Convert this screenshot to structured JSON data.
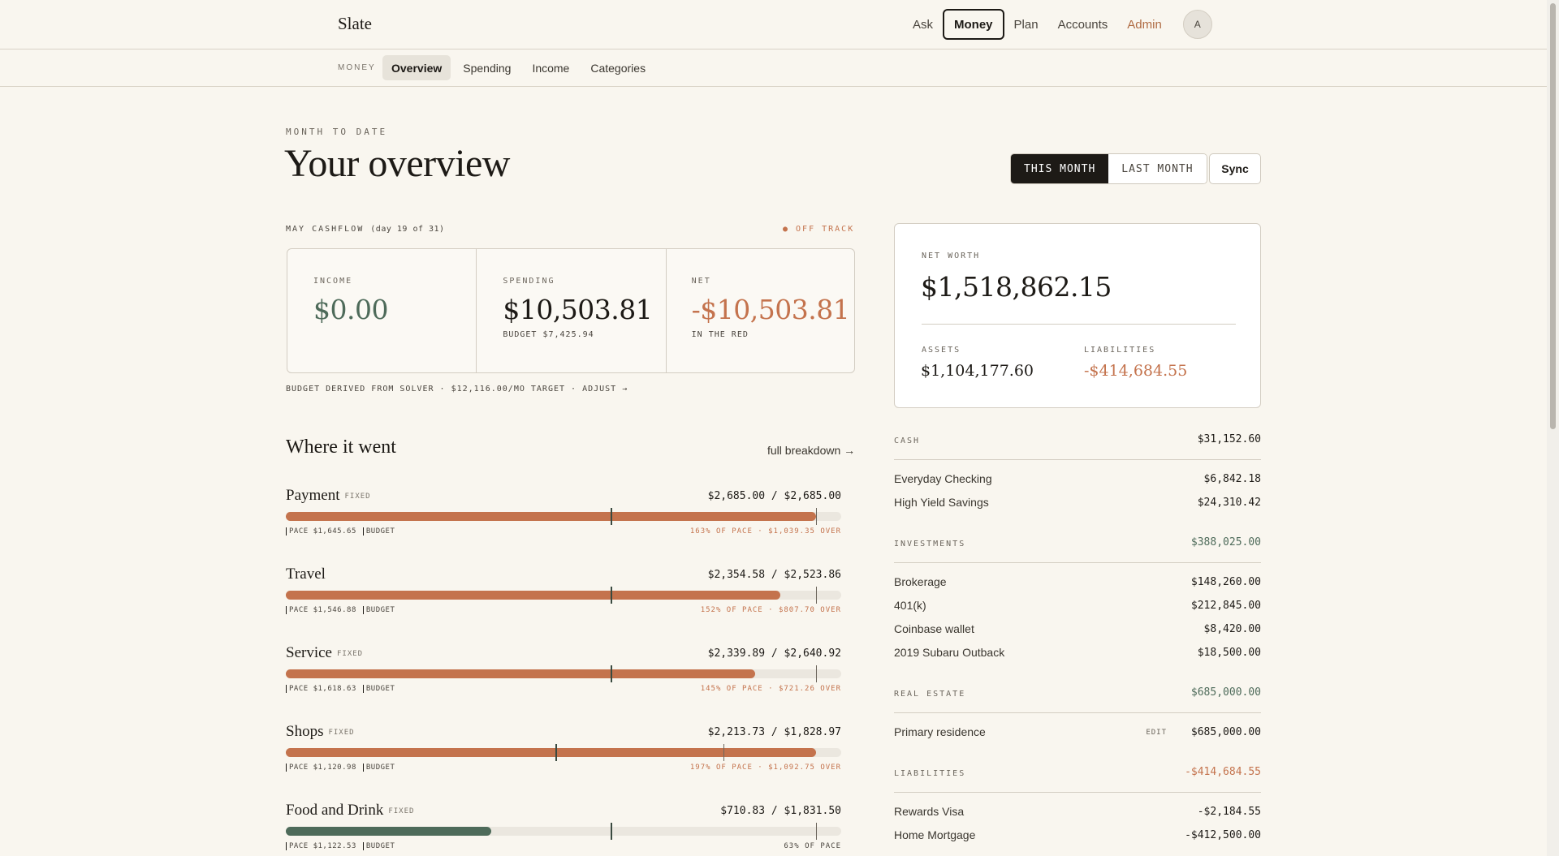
{
  "brand": "Slate",
  "nav": {
    "items": [
      {
        "label": "Ask"
      },
      {
        "label": "Money"
      },
      {
        "label": "Plan"
      },
      {
        "label": "Accounts"
      },
      {
        "label": "Admin"
      }
    ],
    "avatar": "A"
  },
  "subnav": {
    "section": "MONEY",
    "tabs": [
      {
        "label": "Overview"
      },
      {
        "label": "Spending"
      },
      {
        "label": "Income"
      },
      {
        "label": "Categories"
      }
    ]
  },
  "header": {
    "eyebrow": "MONTH TO DATE",
    "title": "Your overview",
    "this_month": "THIS MONTH",
    "last_month": "LAST MONTH",
    "sync": "Sync"
  },
  "cashflow": {
    "title": "MAY CASHFLOW",
    "day": "(day 19 of 31)",
    "status": "● OFF TRACK",
    "income_label": "INCOME",
    "income": "$0.00",
    "spending_label": "SPENDING",
    "spending": "$10,503.81",
    "budget": "BUDGET $7,425.94",
    "net_label": "NET",
    "net": "-$10,503.81",
    "net_sub": "IN THE RED",
    "note": "BUDGET DERIVED FROM SOLVER · $12,116.00/MO TARGET · ADJUST →"
  },
  "where": {
    "title": "Where it went",
    "link": "full breakdown →",
    "categories": [
      {
        "name": "Payment",
        "tag": "FIXED",
        "amount": "$2,685.00 / $2,685.00",
        "pace": "PACE $1,645.65",
        "budget": "BUDGET",
        "status": "163% OF PACE · $1,039.35 OVER",
        "fill": 0.955,
        "pace_pos": 0.585,
        "budget_pos": 0.955
      },
      {
        "name": "Travel",
        "tag": "",
        "amount": "$2,354.58 / $2,523.86",
        "pace": "PACE $1,546.88",
        "budget": "BUDGET",
        "status": "152% OF PACE · $807.70 OVER",
        "fill": 0.89,
        "pace_pos": 0.585,
        "budget_pos": 0.955
      },
      {
        "name": "Service",
        "tag": "FIXED",
        "amount": "$2,339.89 / $2,640.92",
        "pace": "PACE $1,618.63",
        "budget": "BUDGET",
        "status": "145% OF PACE · $721.26 OVER",
        "fill": 0.845,
        "pace_pos": 0.585,
        "budget_pos": 0.955
      },
      {
        "name": "Shops",
        "tag": "FIXED",
        "amount": "$2,213.73 / $1,828.97",
        "pace": "PACE $1,120.98",
        "budget": "BUDGET",
        "status": "197% OF PACE · $1,092.75 OVER",
        "fill": 0.955,
        "pace_pos": 0.485,
        "budget_pos": 0.788
      },
      {
        "name": "Food and Drink",
        "tag": "FIXED",
        "amount": "$710.83 / $1,831.50",
        "pace": "PACE $1,122.53",
        "budget": "BUDGET",
        "status": "63% OF PACE",
        "fill": 0.37,
        "pace_pos": 0.585,
        "budget_pos": 0.955
      }
    ]
  },
  "networth": {
    "label": "NET WORTH",
    "value": "$1,518,862.15",
    "assets_label": "ASSETS",
    "assets": "$1,104,177.60",
    "liabilities_label": "LIABILITIES",
    "liabilities": "-$414,684.55"
  },
  "accounts": {
    "cash": {
      "label": "CASH",
      "total": "$31,152.60",
      "rows": [
        {
          "name": "Everyday Checking",
          "value": "$6,842.18"
        },
        {
          "name": "High Yield Savings",
          "value": "$24,310.42"
        }
      ]
    },
    "investments": {
      "label": "INVESTMENTS",
      "total": "$388,025.00",
      "rows": [
        {
          "name": "Brokerage",
          "value": "$148,260.00"
        },
        {
          "name": "401(k)",
          "value": "$212,845.00"
        },
        {
          "name": "Coinbase wallet",
          "value": "$8,420.00"
        },
        {
          "name": "2019 Subaru Outback",
          "value": "$18,500.00"
        }
      ]
    },
    "real_estate": {
      "label": "REAL ESTATE",
      "total": "$685,000.00",
      "rows": [
        {
          "name": "Primary residence",
          "value": "$685,000.00",
          "edit": "EDIT"
        }
      ]
    },
    "liabilities": {
      "label": "LIABILITIES",
      "total": "-$414,684.55",
      "rows": [
        {
          "name": "Rewards Visa",
          "value": "-$2,184.55"
        },
        {
          "name": "Home Mortgage",
          "value": "-$412,500.00"
        }
      ]
    }
  },
  "colors": {
    "accent": "#c4734d",
    "positive": "#4e6b5a",
    "ink": "#1d1a16",
    "background": "#f9f6ef"
  }
}
